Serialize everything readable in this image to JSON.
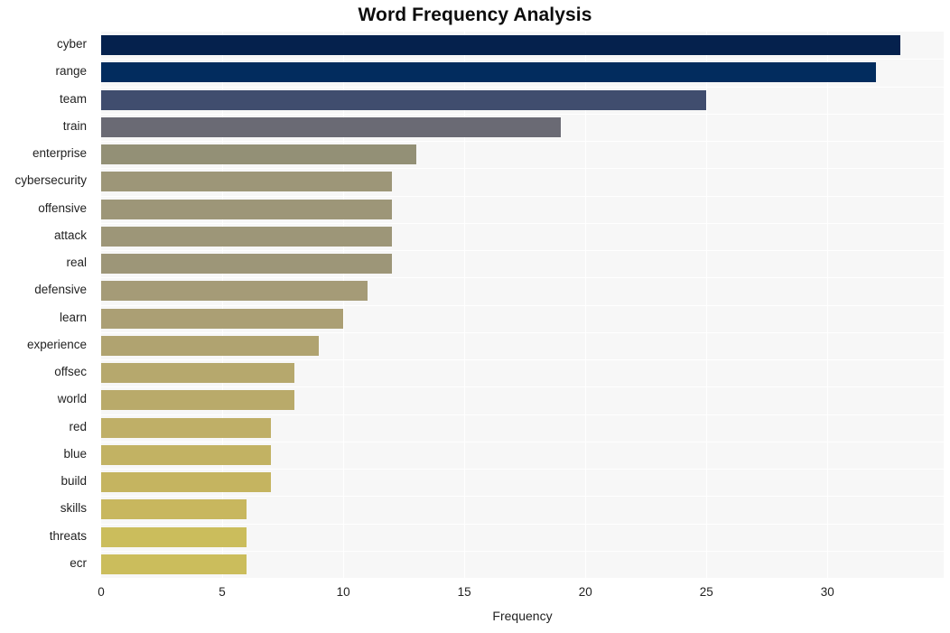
{
  "chart_data": {
    "type": "bar",
    "orientation": "horizontal",
    "title": "Word Frequency Analysis",
    "xlabel": "Frequency",
    "ylabel": "",
    "xlim": [
      0,
      34.8
    ],
    "xticks": [
      0,
      5,
      10,
      15,
      20,
      25,
      30
    ],
    "grid": true,
    "legend": null,
    "categories": [
      "cyber",
      "range",
      "team",
      "train",
      "enterprise",
      "cybersecurity",
      "offensive",
      "attack",
      "real",
      "defensive",
      "learn",
      "experience",
      "offsec",
      "world",
      "red",
      "blue",
      "build",
      "skills",
      "threats",
      "ecr"
    ],
    "values": [
      33,
      32,
      25,
      19,
      13,
      12,
      12,
      12,
      12,
      11,
      10,
      9,
      8,
      8,
      7,
      7,
      7,
      6,
      6,
      6
    ],
    "bar_colors": [
      "#05214d",
      "#022c5e",
      "#404d6e",
      "#6a6a74",
      "#939076",
      "#9d9678",
      "#9d9678",
      "#9d9678",
      "#9d9678",
      "#a59b77",
      "#ab9f74",
      "#b0a370",
      "#b6a86d",
      "#b9aa6a",
      "#bfaf67",
      "#c2b263",
      "#c5b460",
      "#c8b75e",
      "#cbbd5c",
      "#cbbd5c"
    ],
    "plot_background": "#f7f7f7",
    "grid_color": "#ffffff",
    "page_background": "#ffffff",
    "title_color": "#0d0d0d",
    "tick_color": "#222222"
  }
}
